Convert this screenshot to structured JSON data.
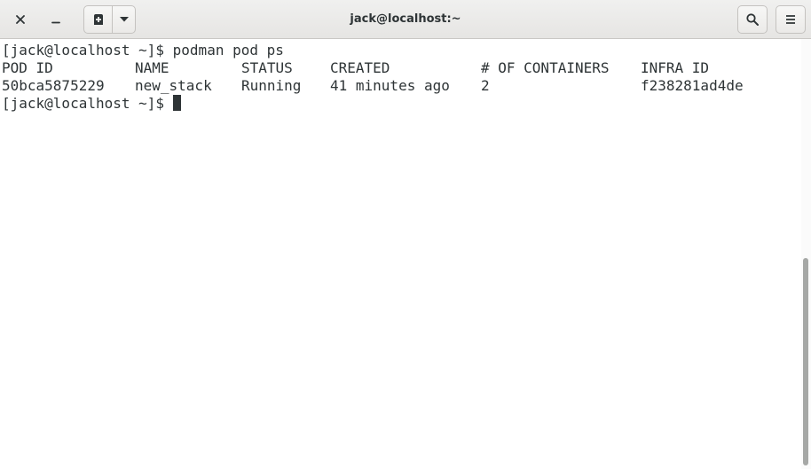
{
  "window": {
    "title": "jack@localhost:~"
  },
  "header": {
    "close_icon": "close-icon",
    "minimize_icon": "minimize-icon",
    "new_tab_icon": "new-tab-icon",
    "new_tab_menu_icon": "chevron-down-icon",
    "search_icon": "search-icon",
    "menu_icon": "hamburger-menu-icon"
  },
  "terminal": {
    "prompt": "[jack@localhost ~]$ ",
    "command": "podman pod ps",
    "table": {
      "headers": [
        "POD ID",
        "NAME",
        "STATUS",
        "CREATED",
        "# OF CONTAINERS",
        "INFRA ID"
      ],
      "rows": [
        [
          "50bca5875229",
          "new_stack",
          "Running",
          "41 minutes ago",
          "2",
          "f238281ad4de"
        ]
      ]
    },
    "prompt2": "[jack@localhost ~]$ "
  },
  "colors": {
    "text": "#2e3436",
    "background": "#ffffff",
    "headerbar": "#e8e7e6"
  }
}
